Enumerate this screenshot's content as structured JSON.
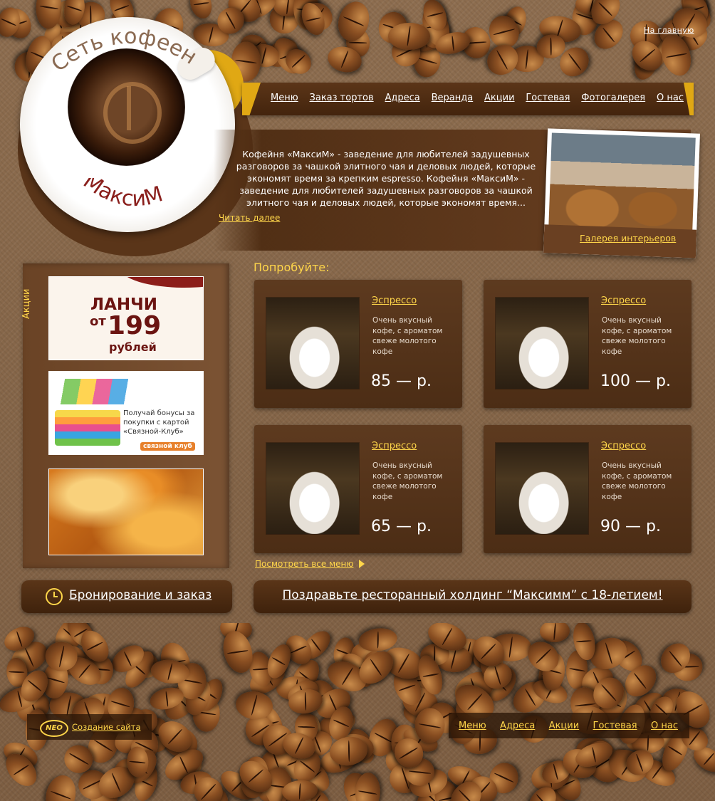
{
  "header": {
    "home_link": "На главную",
    "logo_top": "Сеть кофеен",
    "logo_bottom": "МаксиМ"
  },
  "nav": {
    "items": [
      "Меню",
      "Заказ тортов",
      "Адреса",
      "Веранда",
      "Акции",
      "Гостевая",
      "Фотогалерея",
      "О нас"
    ]
  },
  "intro": {
    "text": "Кофейня «МаксиМ» - заведение для любителей задушевных разговоров за чашкой элитного чая и деловых людей, которые экономят время за крепким espresso. Кофейня «МаксиМ» - заведение для любителей задушевных разговоров за чашкой элитного чая и деловых людей, которые экономят время...",
    "read_more": "Читать далее",
    "gallery_link": "Галерея интерьеров"
  },
  "promos": {
    "label": "Акции",
    "lunch": {
      "word": "ЛАНЧИ",
      "from": "от",
      "price": "199",
      "unit": "рублей"
    },
    "svyaznoy": {
      "text": "Получай бонусы за покупки с картой «Связной-Клуб»",
      "card_brand": "связной",
      "badge": "связной клуб"
    }
  },
  "try": {
    "title": "Попробуйте:",
    "items": [
      {
        "name": "Эспрессо",
        "desc": "Очень вкусный кофе, с ароматом свеже молотого кофе",
        "price": "85 — р."
      },
      {
        "name": "Эспрессо",
        "desc": "Очень вкусный кофе, с ароматом свеже молотого кофе",
        "price": "100 — р."
      },
      {
        "name": "Эспрессо",
        "desc": "Очень вкусный кофе, с ароматом свеже молотого кофе",
        "price": "65 — р."
      },
      {
        "name": "Эспрессо",
        "desc": "Очень вкусный кофе, с ароматом свеже молотого кофе",
        "price": "90 — р."
      }
    ],
    "all_menu": "Посмотреть все меню"
  },
  "booking": {
    "label": "Бронирование и заказ"
  },
  "congrats": {
    "text": "Поздравьте ресторанный холдинг “Максимм” с 18-летием!"
  },
  "footer": {
    "neo_logo": "NEO",
    "credit": "Создание сайта",
    "menu": [
      "Меню",
      "Адреса",
      "Акции",
      "Гостевая",
      "О нас"
    ]
  },
  "colors": {
    "accent": "#ffd64a",
    "brown_dark": "#4c2d15",
    "gold": "#e0a814"
  }
}
